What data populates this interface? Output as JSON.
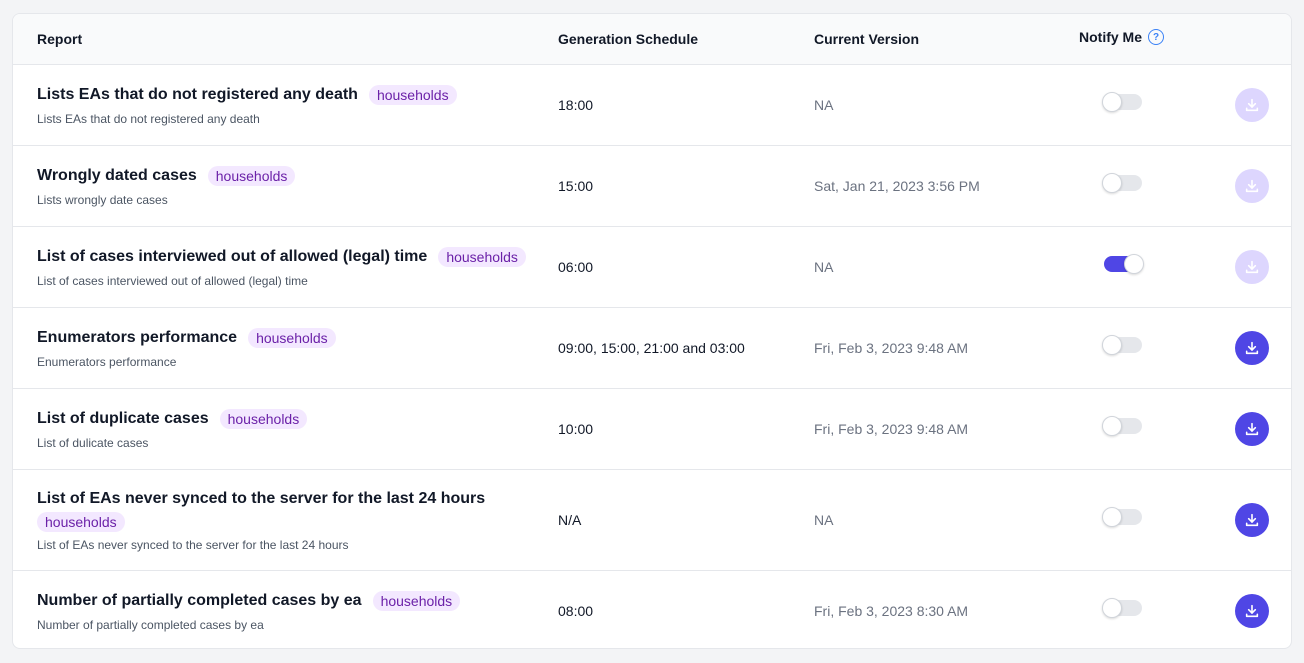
{
  "header": {
    "report": "Report",
    "schedule": "Generation Schedule",
    "version": "Current Version",
    "notify": "Notify Me",
    "help_glyph": "?"
  },
  "icons": {
    "help": "question-circle-icon",
    "download": "download-icon"
  },
  "colors": {
    "accent": "#4f46e5",
    "accent_disabled": "#ddd6fe",
    "badge_bg": "#f3e8ff",
    "badge_text": "#6b21a8"
  },
  "rows": [
    {
      "title": "Lists EAs that do not registered any death",
      "tag": "households",
      "description": "Lists EAs that do not registered any death",
      "schedule": "18:00",
      "version": "NA",
      "notify": false,
      "download_enabled": false
    },
    {
      "title": "Wrongly dated cases",
      "tag": "households",
      "description": "Lists wrongly date cases",
      "schedule": "15:00",
      "version": "Sat, Jan 21, 2023 3:56 PM",
      "notify": false,
      "download_enabled": false
    },
    {
      "title": "List of cases interviewed out of allowed (legal) time",
      "tag": "households",
      "description": "List of cases interviewed out of allowed (legal) time",
      "schedule": "06:00",
      "version": "NA",
      "notify": true,
      "download_enabled": false
    },
    {
      "title": "Enumerators performance",
      "tag": "households",
      "description": "Enumerators performance",
      "schedule": "09:00, 15:00, 21:00 and 03:00",
      "version": "Fri, Feb 3, 2023 9:48 AM",
      "notify": false,
      "download_enabled": true
    },
    {
      "title": "List of duplicate cases",
      "tag": "households",
      "description": "List of dulicate cases",
      "schedule": "10:00",
      "version": "Fri, Feb 3, 2023 9:48 AM",
      "notify": false,
      "download_enabled": true
    },
    {
      "title": "List of EAs never synced to the server for the last 24 hours",
      "tag": "households",
      "description": "List of EAs never synced to the server for the last 24 hours",
      "schedule": "N/A",
      "version": "NA",
      "notify": false,
      "download_enabled": true
    },
    {
      "title": "Number of partially completed cases by ea",
      "tag": "households",
      "description": "Number of partially completed cases by ea",
      "schedule": "08:00",
      "version": "Fri, Feb 3, 2023 8:30 AM",
      "notify": false,
      "download_enabled": true
    }
  ]
}
